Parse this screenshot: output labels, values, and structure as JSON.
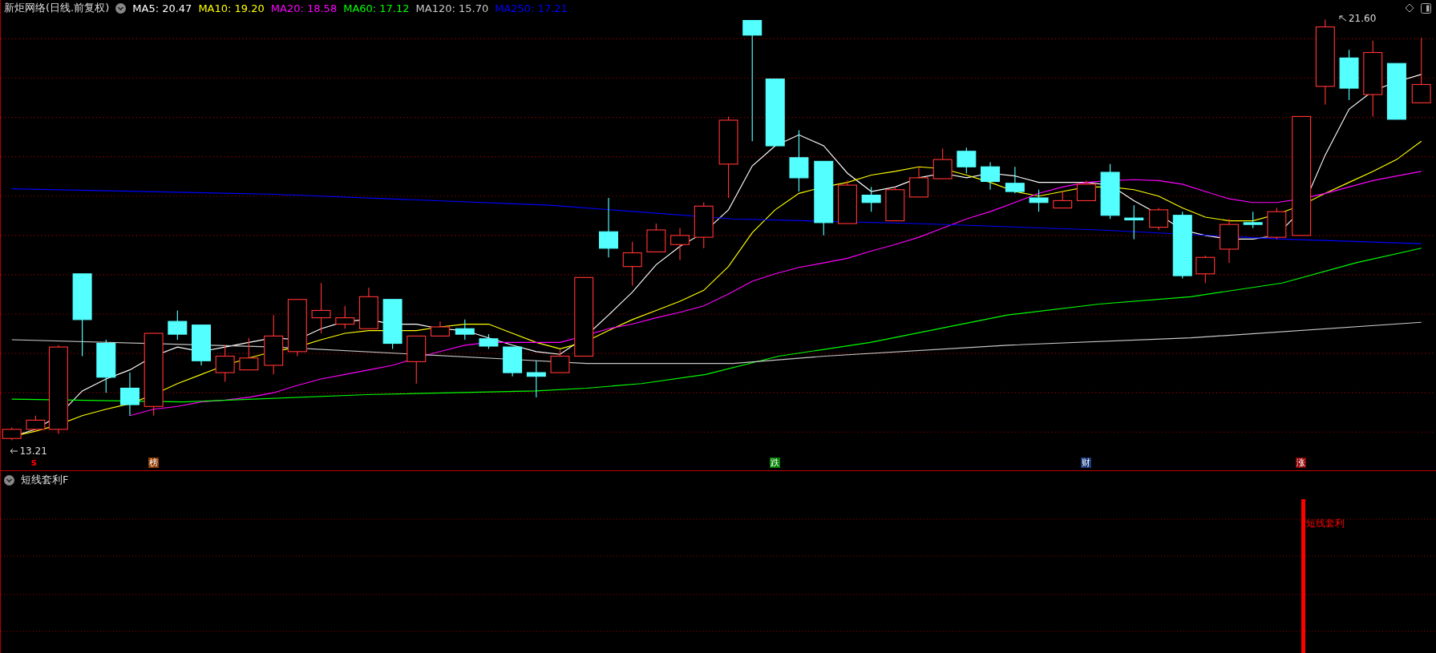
{
  "title": "新炬网络(日线.前复权)",
  "moving_averages": [
    {
      "label": "MA5: 20.47",
      "color": "#ffffff"
    },
    {
      "label": "MA10: 19.20",
      "color": "#ffff00"
    },
    {
      "label": "MA20: 18.58",
      "color": "#ff00ff"
    },
    {
      "label": "MA60: 17.12",
      "color": "#00ff00"
    },
    {
      "label": "MA120: 15.70",
      "color": "#c8c8c8"
    },
    {
      "label": "MA250: 17.21",
      "color": "#0000ff"
    }
  ],
  "price_labels": [
    {
      "kind": "high",
      "text": "21.60"
    },
    {
      "kind": "low",
      "text": "13.21"
    }
  ],
  "markers": [
    {
      "text": "s",
      "color": "#ff0000"
    },
    {
      "text": "榜",
      "color": "#8b3a00"
    },
    {
      "text": "跌",
      "color": "#008000"
    },
    {
      "text": "财",
      "color": "#1a3a7a"
    },
    {
      "text": "涨",
      "color": "#8b0000"
    }
  ],
  "indicator": {
    "title": "短线套利F",
    "signal_label": "短线套利"
  }
}
